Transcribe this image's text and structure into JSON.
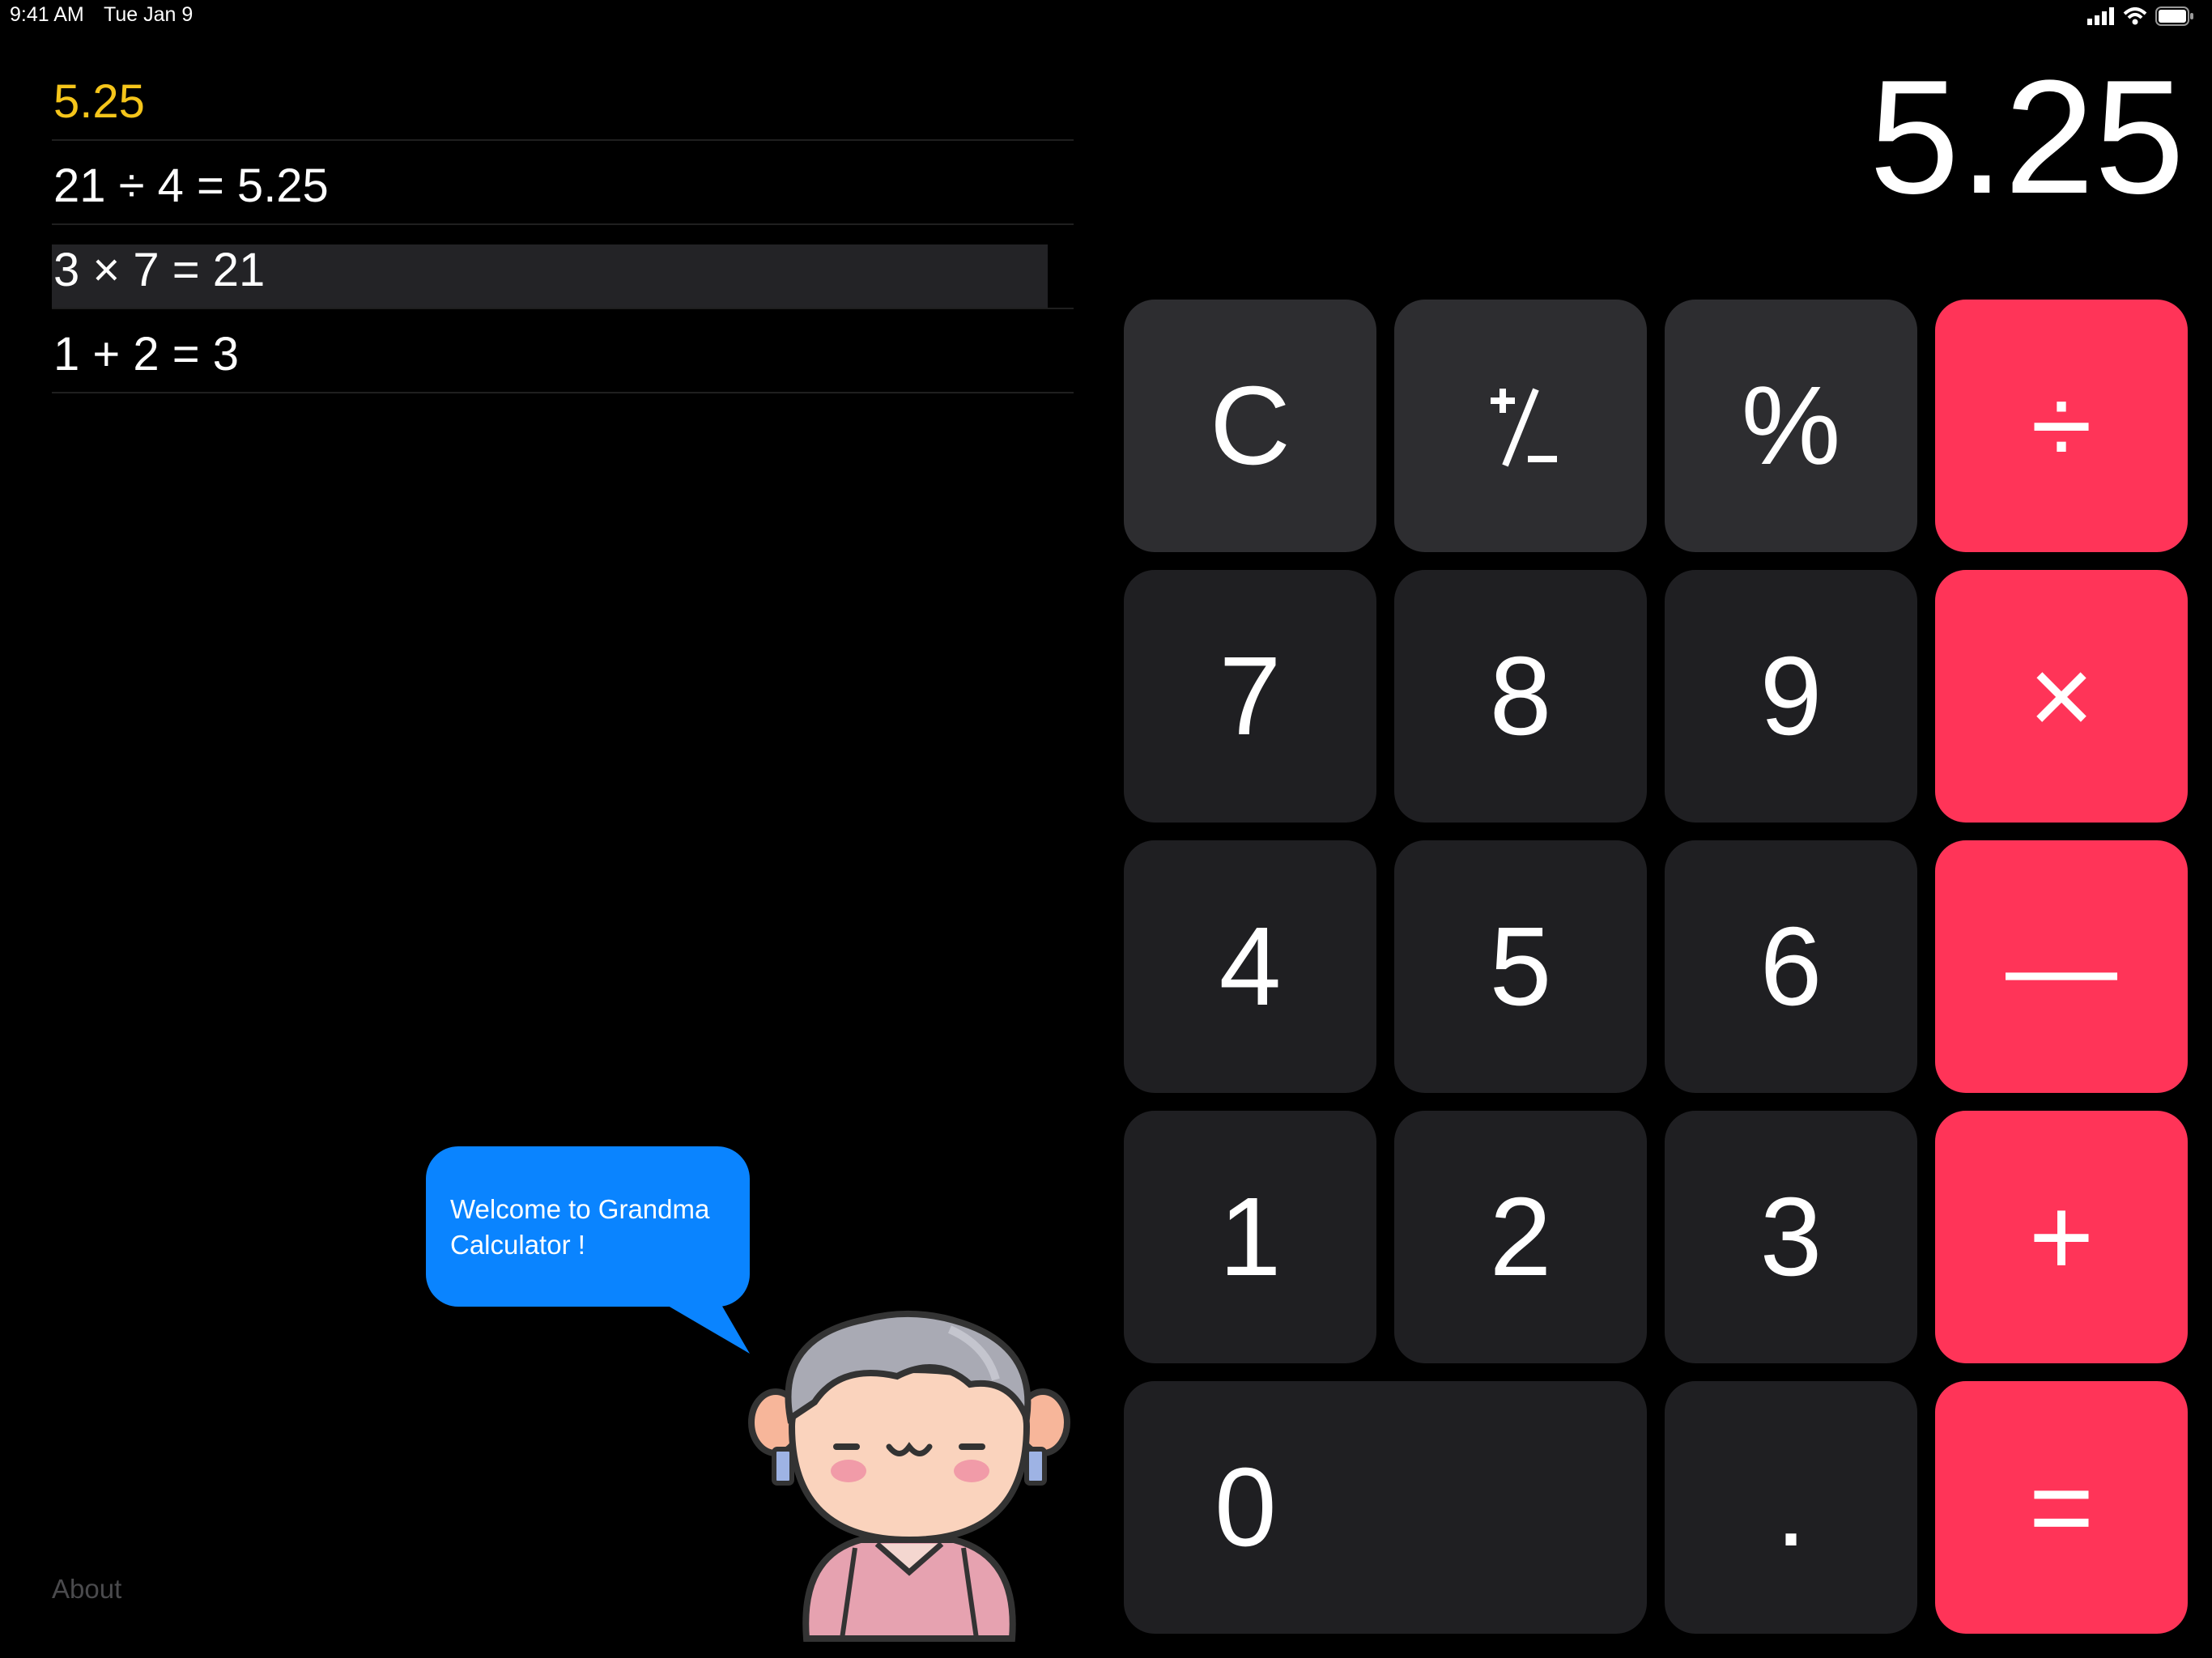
{
  "status_bar": {
    "time": "9:41 AM",
    "date": "Tue Jan 9"
  },
  "history": {
    "current": "5.25",
    "entries": [
      "21 ÷ 4 = 5.25",
      "3 × 7 = 21",
      "1 + 2 = 3"
    ]
  },
  "display": {
    "value": "5.25"
  },
  "keypad": {
    "clear": "C",
    "plus_minus_icon": "plus-minus-icon",
    "percent": "%",
    "divide": "÷",
    "seven": "7",
    "eight": "8",
    "nine": "9",
    "multiply": "×",
    "four": "4",
    "five": "5",
    "six": "6",
    "minus": "—",
    "one": "1",
    "two": "2",
    "three": "3",
    "plus": "+",
    "zero": "0",
    "decimal": ".",
    "equals": "="
  },
  "bubble": {
    "text": "Welcome to Grandma Calculator !"
  },
  "footer": {
    "about": "About"
  },
  "colors": {
    "operator": "#FF3458",
    "function_key": "#2d2d30",
    "number_key": "#1f1f22",
    "accent_yellow": "#F5C51A",
    "bubble": "#0A84FF"
  }
}
